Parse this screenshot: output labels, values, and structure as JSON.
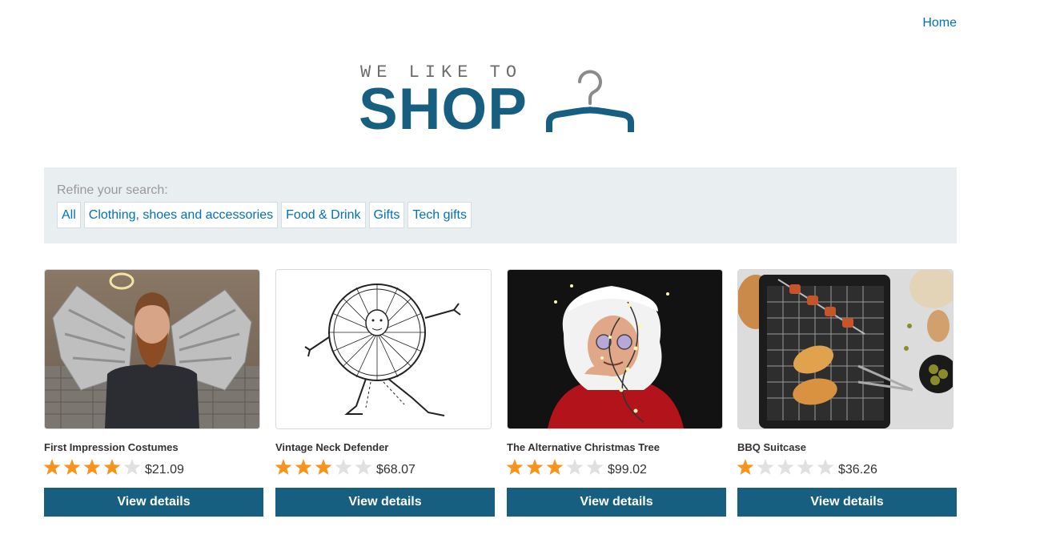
{
  "nav": {
    "home_label": "Home"
  },
  "logo": {
    "tagline": "WE LIKE TO",
    "word": "SHOP",
    "icon": "hanger-icon",
    "brand_color": "#175f80"
  },
  "filters": {
    "label": "Refine your search:",
    "items": [
      "All",
      "Clothing, shoes and accessories",
      "Food & Drink",
      "Gifts",
      "Tech gifts"
    ]
  },
  "products": [
    {
      "name": "First Impression Costumes",
      "rating": 4,
      "max_rating": 5,
      "price": "$21.09",
      "button_label": "View details",
      "image": "bearded man with angel wings and halo"
    },
    {
      "name": "Vintage Neck Defender",
      "rating": 3,
      "max_rating": 5,
      "price": "$68.07",
      "button_label": "View details",
      "image": "ink drawing of man wearing giant round neck collar"
    },
    {
      "name": "The Alternative Christmas Tree",
      "rating": 3,
      "max_rating": 5,
      "price": "$99.02",
      "button_label": "View details",
      "image": "man in santa wig wrapped in fairy lights"
    },
    {
      "name": "BBQ Suitcase",
      "rating": 1,
      "max_rating": 5,
      "price": "$36.26",
      "button_label": "View details",
      "image": "portable grill with skewers and corn"
    }
  ],
  "colors": {
    "link": "#0071bc",
    "button": "#175f80",
    "star_filled": "#f7941d",
    "star_empty": "#e0e0e0",
    "panel": "#e9eef1"
  }
}
